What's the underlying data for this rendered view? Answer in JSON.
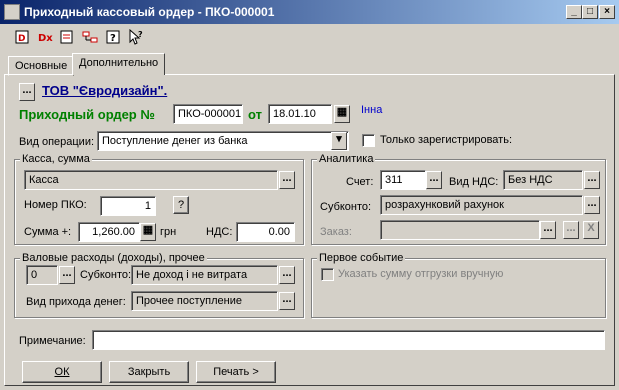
{
  "window": {
    "title": "Приходный кассовый ордер - ПКО-000001"
  },
  "toolbar": {
    "icons": [
      "dt-kt-icon",
      "dt-kt-red-icon",
      "document-icon",
      "structure-icon",
      "help-icon",
      "pointer-help-icon"
    ]
  },
  "tabs": [
    {
      "label": "Основные"
    },
    {
      "label": "Дополнительно"
    }
  ],
  "org": {
    "name": "ТОВ \"Євродизайн\"."
  },
  "order": {
    "label": "Приходный ордер №",
    "number": "ПКО-000001",
    "date_label": "от",
    "date": "18.01.10",
    "user": "Інна"
  },
  "operation": {
    "label": "Вид операции:",
    "value": "Поступление денег из банка",
    "only_registered_label": "Только зарегистрировать:"
  },
  "kassa": {
    "group_title": "Касса, сумма",
    "kassa_value": "Касса",
    "pko_label": "Номер ПКО:",
    "pko_value": "1",
    "question": "?",
    "sum_label": "Сумма +:",
    "sum_value": "1,260.00",
    "currency": "грн",
    "nds_label": "НДС:",
    "nds_value": "0.00"
  },
  "analytics": {
    "group_title": "Аналитика",
    "schet_label": "Счет:",
    "schet_value": "311",
    "vid_nds_label": "Вид НДС:",
    "vid_nds_value": "Без НДС",
    "subkonto_label": "Субконто:",
    "subkonto_value": "розрахунковий рахунок",
    "zakaz_label": "Заказ:",
    "zakaz_value": "",
    "x_label": "X"
  },
  "valovye": {
    "group_title": "Валовые расходы (доходы), прочее",
    "code": "0",
    "subkonto_label": "Субконто:",
    "subkonto_value": "Не доход і не витрата",
    "vid_label": "Вид прихода денег:",
    "vid_value": "Прочее поступление"
  },
  "first_event": {
    "group_title": "Первое событие",
    "checkbox_label": "Указать сумму отгрузки вручную"
  },
  "note": {
    "label": "Примечание:",
    "value": ""
  },
  "buttons": {
    "ok": "ОК",
    "close": "Закрыть",
    "print": "Печать >"
  },
  "dots": "..."
}
